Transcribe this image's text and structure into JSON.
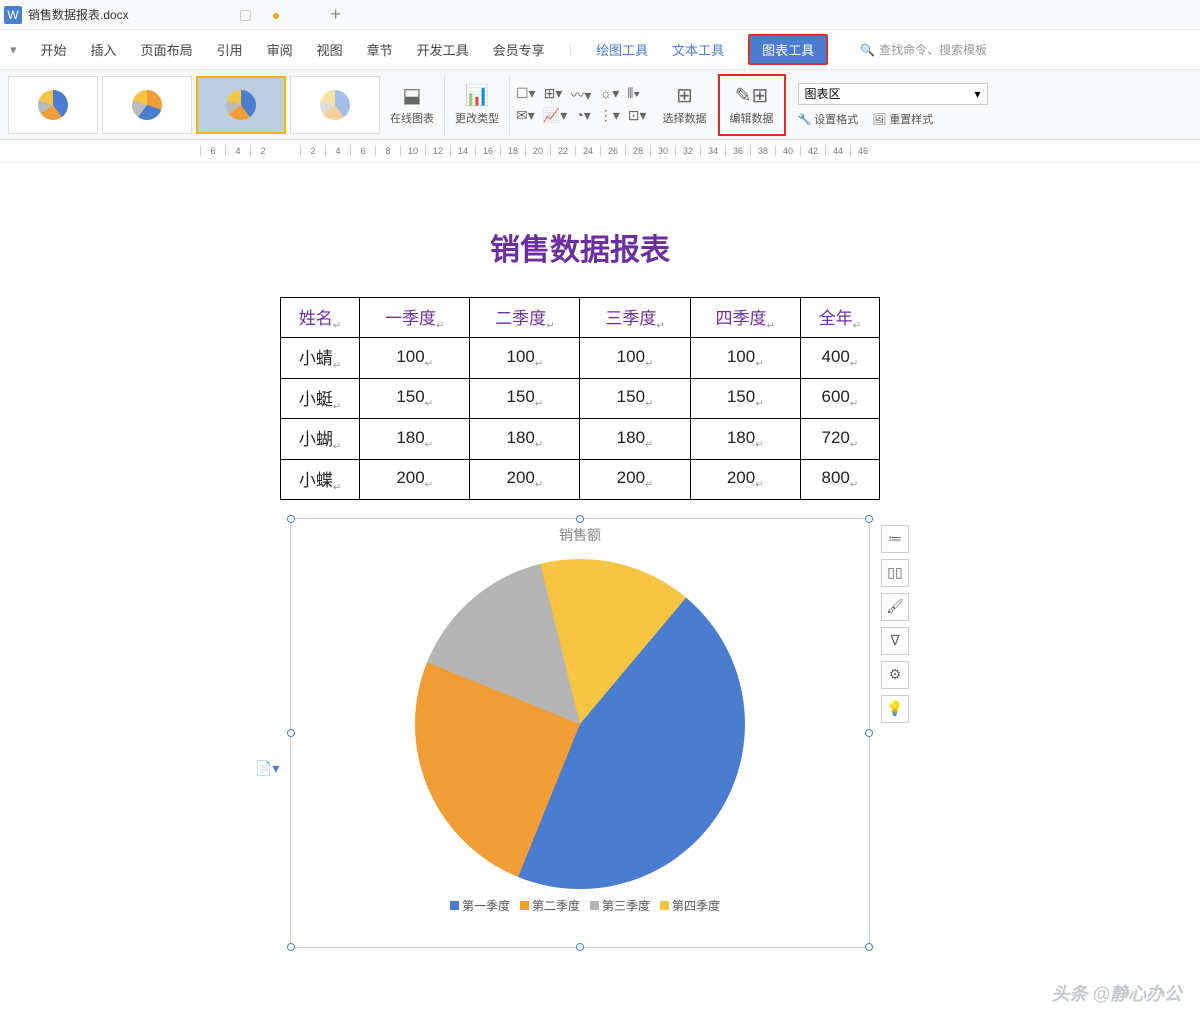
{
  "titlebar": {
    "filename": "销售数据报表.docx"
  },
  "menu": {
    "items": [
      "开始",
      "插入",
      "页面布局",
      "引用",
      "审阅",
      "视图",
      "章节",
      "开发工具",
      "会员专享"
    ],
    "drawing": "绘图工具",
    "text": "文本工具",
    "chart": "图表工具",
    "search_placeholder": "查找命令、搜索模板"
  },
  "toolbar": {
    "online_chart": "在线图表",
    "change_type": "更改类型",
    "select_data": "选择数据",
    "edit_data": "编辑数据",
    "chart_area": "图表区",
    "set_format": "设置格式",
    "reset_style": "重置样式"
  },
  "ruler": [
    "6",
    "4",
    "2",
    "",
    "2",
    "4",
    "6",
    "8",
    "10",
    "12",
    "14",
    "16",
    "18",
    "20",
    "22",
    "24",
    "26",
    "28",
    "30",
    "32",
    "34",
    "36",
    "38",
    "40",
    "42",
    "44",
    "46"
  ],
  "doc": {
    "title": "销售数据报表",
    "headers": [
      "姓名",
      "一季度",
      "二季度",
      "三季度",
      "四季度",
      "全年"
    ],
    "rows": [
      [
        "小蜻",
        "100",
        "100",
        "100",
        "100",
        "400"
      ],
      [
        "小蜓",
        "150",
        "150",
        "150",
        "150",
        "600"
      ],
      [
        "小蝴",
        "180",
        "180",
        "180",
        "180",
        "720"
      ],
      [
        "小蝶",
        "200",
        "200",
        "200",
        "200",
        "800"
      ]
    ]
  },
  "chart_data": {
    "type": "pie",
    "title": "销售额",
    "categories": [
      "第一季度",
      "第二季度",
      "第三季度",
      "第四季度"
    ],
    "values": [
      45,
      25,
      15,
      15
    ],
    "colors": [
      "#4a7dd0",
      "#f29e38",
      "#b5b5b5",
      "#f6c543"
    ]
  },
  "watermark": "头条 @静心办公"
}
